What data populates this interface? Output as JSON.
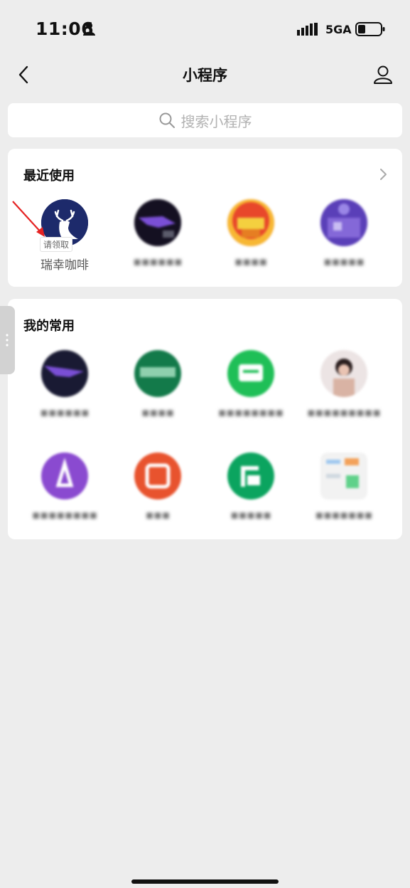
{
  "status_bar": {
    "time": "11:06",
    "network": "5GA",
    "icons": [
      "person-icon",
      "signal-icon",
      "battery-icon"
    ]
  },
  "nav": {
    "title": "小程序",
    "icons": [
      "back-icon",
      "profile-icon"
    ]
  },
  "search": {
    "placeholder": "搜索小程序",
    "icon": "search-icon"
  },
  "recent": {
    "title": "最近使用",
    "apps": [
      {
        "name": "瑞幸咖啡",
        "badge": "请领取",
        "color": "#1d2a6b",
        "blurred": false
      },
      {
        "name": "",
        "color": "#2a1d55",
        "blurred": true
      },
      {
        "name": "",
        "color": "#e8472b",
        "blurred": true
      },
      {
        "name": "",
        "color": "#6b49c9",
        "blurred": true
      }
    ]
  },
  "favorites": {
    "title": "我的常用",
    "apps": [
      {
        "name": "",
        "color": "#191a33",
        "blurred": true
      },
      {
        "name": "",
        "color": "#137a4a",
        "blurred": true
      },
      {
        "name": "",
        "color": "#1fbf57",
        "blurred": true
      },
      {
        "name": "",
        "color": "#e6dede",
        "blurred": true
      },
      {
        "name": "",
        "color": "#8a4ad0",
        "blurred": true
      },
      {
        "name": "",
        "color": "#e8532e",
        "blurred": true
      },
      {
        "name": "",
        "color": "#0ba45f",
        "blurred": true
      },
      {
        "name": "",
        "color": "#f2f2f2",
        "blurred": true
      }
    ]
  },
  "colors": {
    "background": "#ededed",
    "card": "#ffffff",
    "annotation_arrow": "#e52222"
  }
}
